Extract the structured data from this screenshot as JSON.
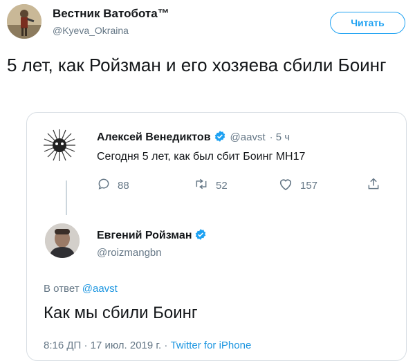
{
  "tweet": {
    "author_name": "Вестник Ватобота™",
    "author_handle": "@Kyeva_Okraina",
    "follow_label": "Читать",
    "text": "5 лет, как Ройзман и его хозяева сбили Боинг"
  },
  "quoted": {
    "first": {
      "name": "Алексей Венедиктов",
      "handle": "@aavst",
      "time": "· 5 ч",
      "text": "Сегодня 5 лет, как был сбит Боинг MH17",
      "replies": "88",
      "retweets": "52",
      "likes": "157"
    },
    "second": {
      "name": "Евгений Ройзман",
      "handle": "@roizmangbn",
      "reply_prefix": "В ответ",
      "reply_handle": "@aavst",
      "text": "Как мы сбили Боинг",
      "timestamp": "8:16 ДП · 17 июл. 2019 г. ·",
      "source": "Twitter for iPhone"
    }
  },
  "colors": {
    "accent": "#1da1f2",
    "link": "#1b95e0",
    "muted": "#657786",
    "border": "#d7dde3"
  }
}
